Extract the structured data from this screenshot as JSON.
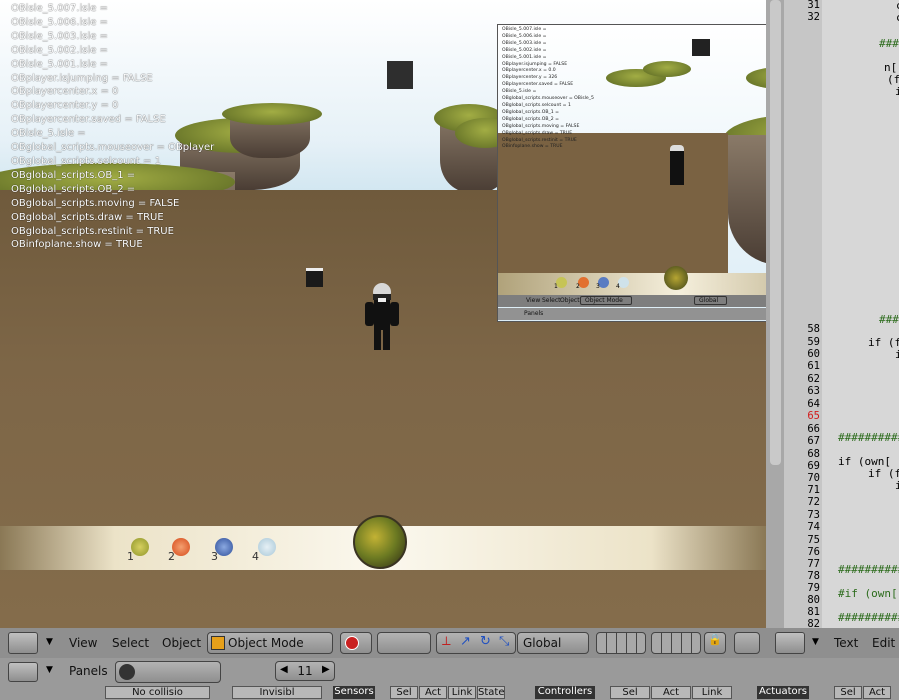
{
  "debug_lines": [
    "OBisle_5.007.isle =",
    "OBisle_5.006.isle =",
    "OBisle_5.003.isle =",
    "OBisle_5.002.isle =",
    "OBisle_5.001.isle =",
    "OBplayer.isjumping = FALSE",
    "OBplayercenter.x = 0",
    "OBplayercenter.y = 0",
    "OBplayercenter.saved = FALSE",
    "OBisle_5.isle =",
    "OBglobal_scripts.mouseover = OBplayer",
    "OBglobal_scripts.selcount = 1",
    "OBglobal_scripts.OB_1 =",
    "OBglobal_scripts.OB_2 =",
    "OBglobal_scripts.moving = FALSE",
    "OBglobal_scripts.draw = TRUE",
    "OBglobal_scripts.restinit = TRUE",
    "OBinfoplane.show = TRUE"
  ],
  "hud": {
    "slots": [
      "1",
      "2",
      "3",
      "4"
    ]
  },
  "inset": {
    "debug_lines": [
      "OBisle_5.007.isle =",
      "OBisle_5.006.isle =",
      "OBisle_5.003.isle =",
      "OBisle_5.002.isle =",
      "OBisle_5.001.isle =",
      "OBplayer.isjumping = FALSE",
      "OBplayercenter.x = 0.0",
      "OBplayercenter.y = 326",
      "OBplayercenter.saved = FALSE",
      "OBisle_5.isle =",
      "OBglobal_scripts.mouseover = OBisle_5",
      "OBglobal_scripts.selcount = 1",
      "OBglobal_scripts.OB_1 =",
      "OBglobal_scripts.OB_2 =",
      "OBglobal_scripts.moving = FALSE",
      "OBglobal_scripts.draw = TRUE",
      "OBglobal_scripts.restinit = TRUE",
      "OBinfoplane.show = TRUE"
    ],
    "hud_slots": [
      "1",
      "2",
      "3",
      "4"
    ],
    "toolbar": {
      "view": "View",
      "select": "Select",
      "object": "Object",
      "mode": "Object Mode",
      "orientation": "Global"
    },
    "toolbar2": {
      "panels": "Panels"
    }
  },
  "header3d": {
    "view": "View",
    "select": "Select",
    "object": "Object",
    "mode": "Object Mode",
    "orientation": "Global"
  },
  "text_header": {
    "text": "Text",
    "edit": "Edit"
  },
  "buttons_header": {
    "panels": "Panels",
    "frame": "11"
  },
  "logic": {
    "no_collision": "No collisio",
    "invisible": "Invisibl",
    "sensors": "Sensors",
    "controllers": "Controllers",
    "actuators": "Actuators",
    "sel": "Sel",
    "act": "Act",
    "link": "Link",
    "state": "State"
  },
  "editor": {
    "line_numbers": [
      "31",
      "32",
      "58",
      "59",
      "60",
      "61",
      "62",
      "63",
      "64",
      "65",
      "66",
      "67",
      "68",
      "69",
      "70",
      "71",
      "72",
      "73",
      "74",
      "75",
      "76",
      "77",
      "78",
      "79",
      "80",
      "81",
      "82"
    ],
    "highlighted_line": "65",
    "code": {
      "l31": "c",
      "l32": "c",
      "hash1": "####",
      "idx": "n[",
      "paren": "(f",
      "i1": "i",
      "hash2": "####",
      "if1": "if (f",
      "i2": "i",
      "hash3": "##########",
      "if2": "if (own[",
      "if3": "if (f",
      "i3": "i",
      "hash4": "##########",
      "comment": "#if (own[",
      "hash5": "##########"
    }
  }
}
